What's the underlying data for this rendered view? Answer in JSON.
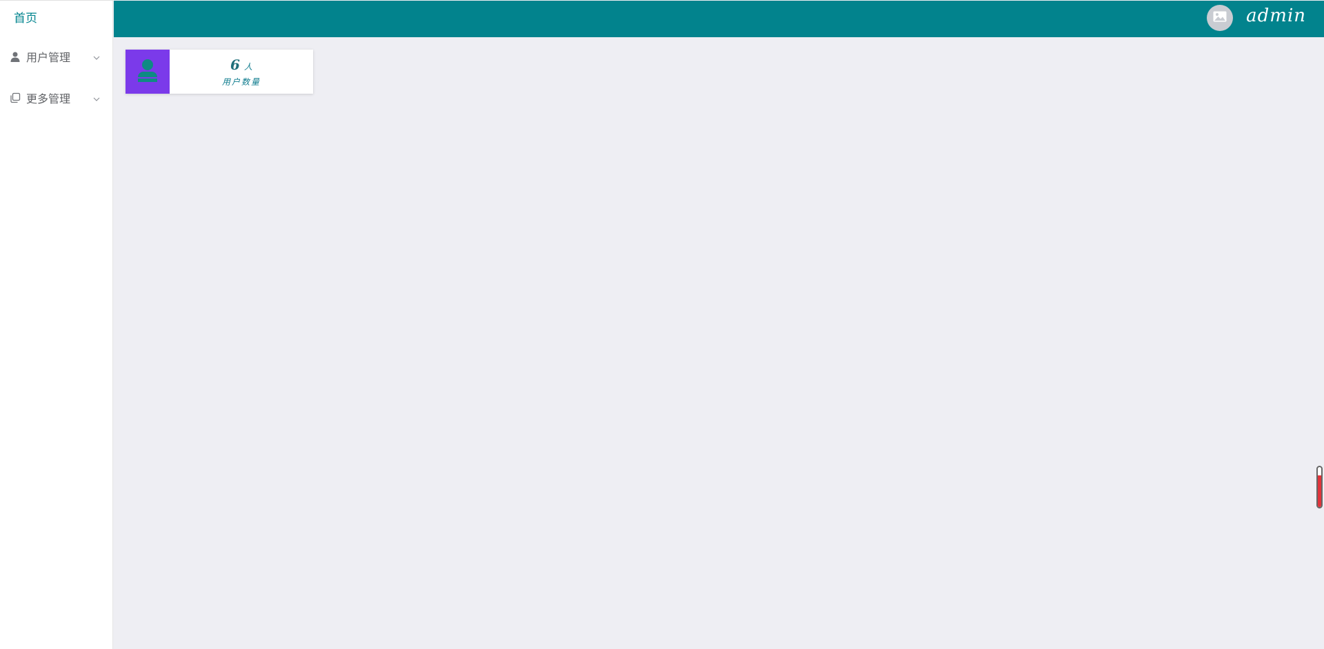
{
  "sidebar": {
    "home_label": "首页",
    "items": [
      {
        "label": "用户管理",
        "icon": "user-icon"
      },
      {
        "label": "更多管理",
        "icon": "copy-icon"
      }
    ]
  },
  "header": {
    "avatar_icon": "image-icon",
    "username": "admin",
    "background": "#02838d"
  },
  "stats": {
    "user_count": {
      "value": "6",
      "unit": "人",
      "label": "用户数量",
      "icon": "user-icon",
      "icon_bg": "#7b3aea",
      "icon_color": "#0e8a83"
    }
  },
  "scroll_widget": {
    "fill_color": "#e0343b",
    "level": 0.8
  }
}
